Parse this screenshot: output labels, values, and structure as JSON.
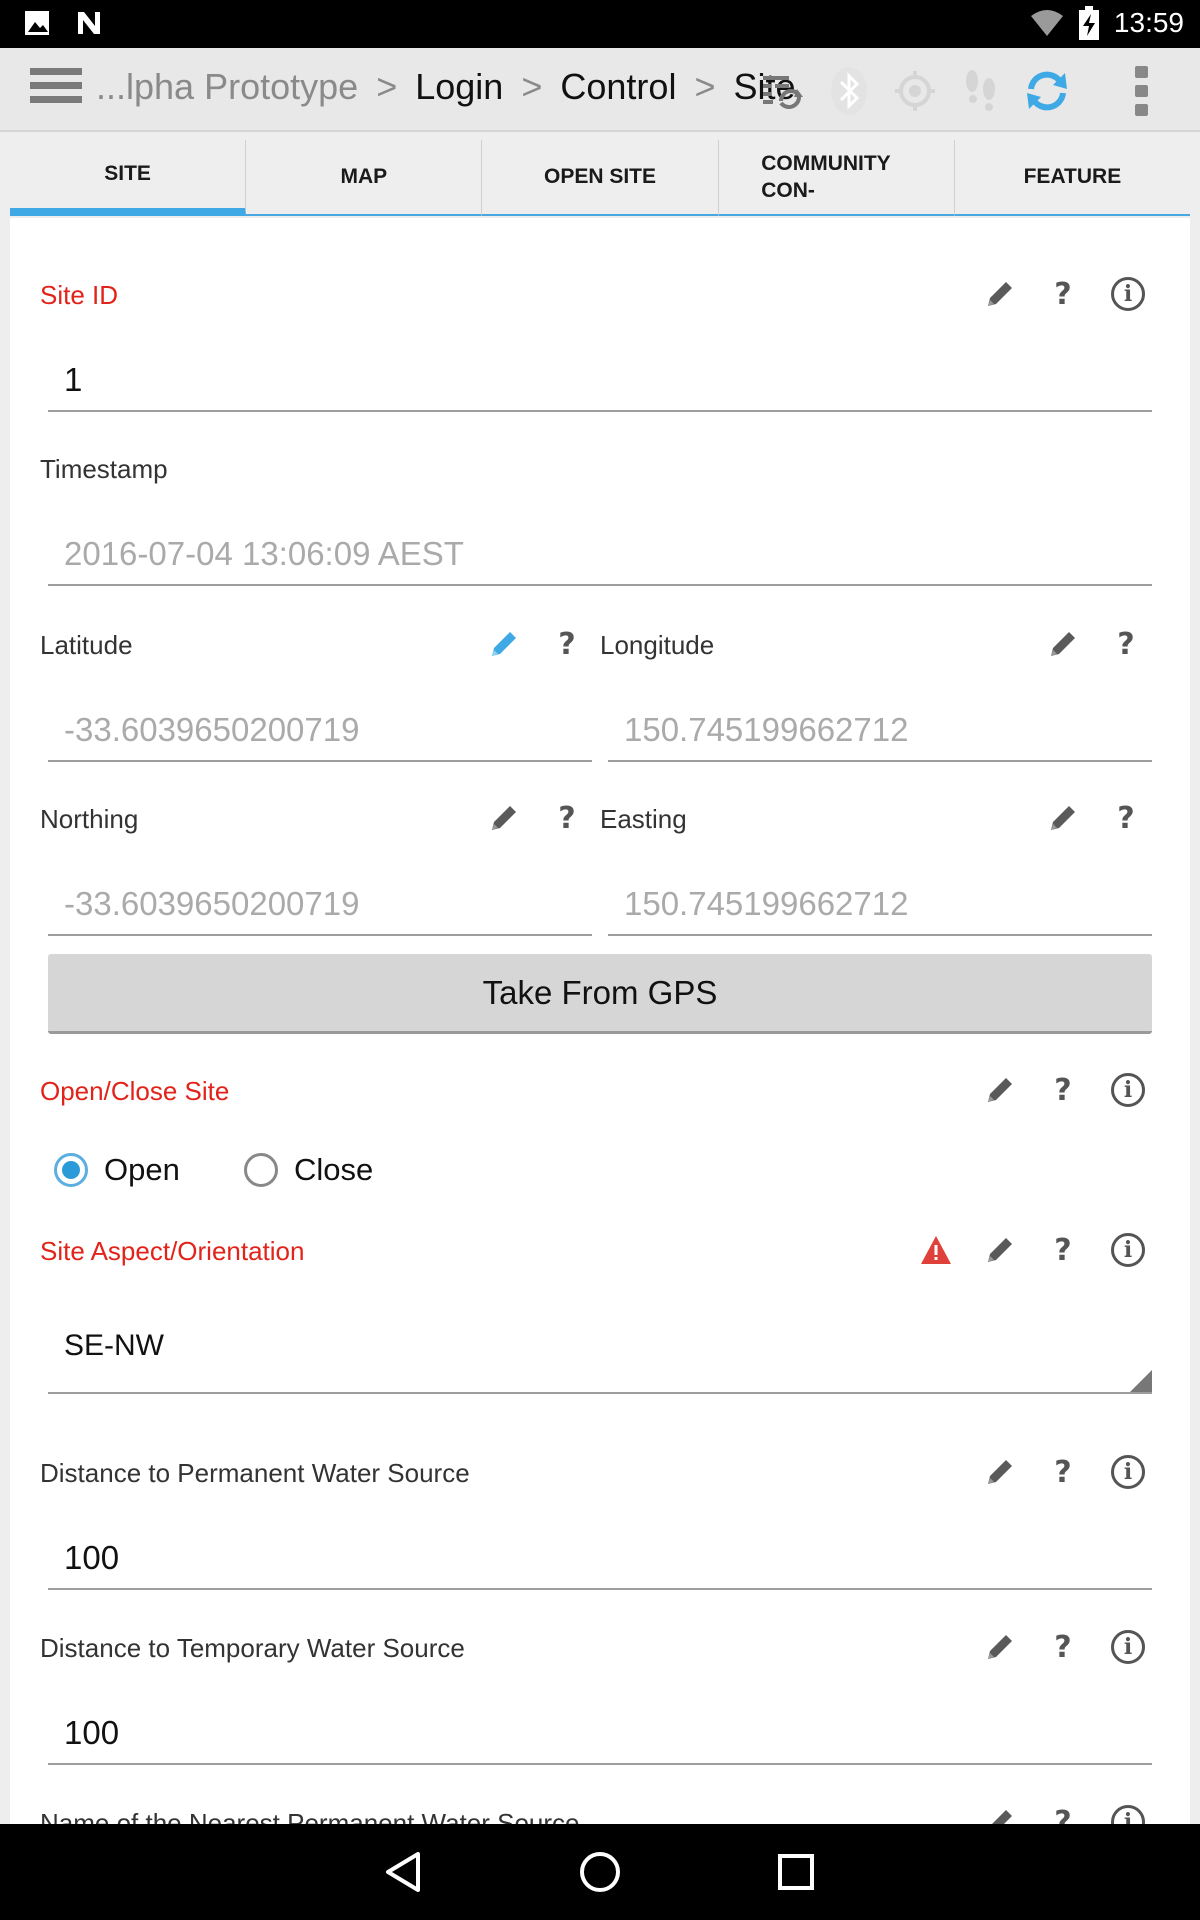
{
  "status_bar": {
    "time": "13:59",
    "icons": [
      "image-notification-icon",
      "n-logo-icon",
      "wifi-icon",
      "battery-charging-icon"
    ]
  },
  "app_bar": {
    "breadcrumb": {
      "root": "...lpha Prototype",
      "items": [
        "Login",
        "Control",
        "Site"
      ],
      "separator": ">"
    },
    "icons": [
      "sync-list-icon",
      "bluetooth-icon",
      "gps-target-icon",
      "footsteps-icon",
      "refresh-icon",
      "overflow-menu-icon"
    ],
    "accent_color": "#3fa9e6"
  },
  "tabs": [
    {
      "label": "SITE",
      "active": true
    },
    {
      "label": "MAP"
    },
    {
      "label": "OPEN SITE"
    },
    {
      "label": "COMMUNITY CON-"
    },
    {
      "label": "FEATURE"
    }
  ],
  "fields": {
    "site_id": {
      "label": "Site ID",
      "value": "1",
      "required": true
    },
    "timestamp": {
      "label": "Timestamp",
      "value": "2016-07-04 13:06:09 AEST"
    },
    "latitude": {
      "label": "Latitude",
      "value": "-33.6039650200719"
    },
    "longitude": {
      "label": "Longitude",
      "value": "150.745199662712"
    },
    "northing": {
      "label": "Northing",
      "value": "-33.6039650200719"
    },
    "easting": {
      "label": "Easting",
      "value": "150.745199662712"
    },
    "gps_button": "Take From GPS",
    "open_close": {
      "label": "Open/Close Site",
      "options": [
        "Open",
        "Close"
      ],
      "selected": "Open",
      "required": true
    },
    "aspect": {
      "label": "Site Aspect/Orientation",
      "value": "SE-NW",
      "required": true,
      "warning": true
    },
    "perm_water": {
      "label": "Distance to Permanent Water Source",
      "value": "100"
    },
    "temp_water": {
      "label": "Distance to Temporary Water Source",
      "value": "100"
    },
    "nearest_perm": {
      "label": "Name of the Nearest Permanent Water Source"
    }
  },
  "colors": {
    "required_label": "#e2231a",
    "pencil_active": "#3fa9e6",
    "warning": "#e0403a"
  }
}
